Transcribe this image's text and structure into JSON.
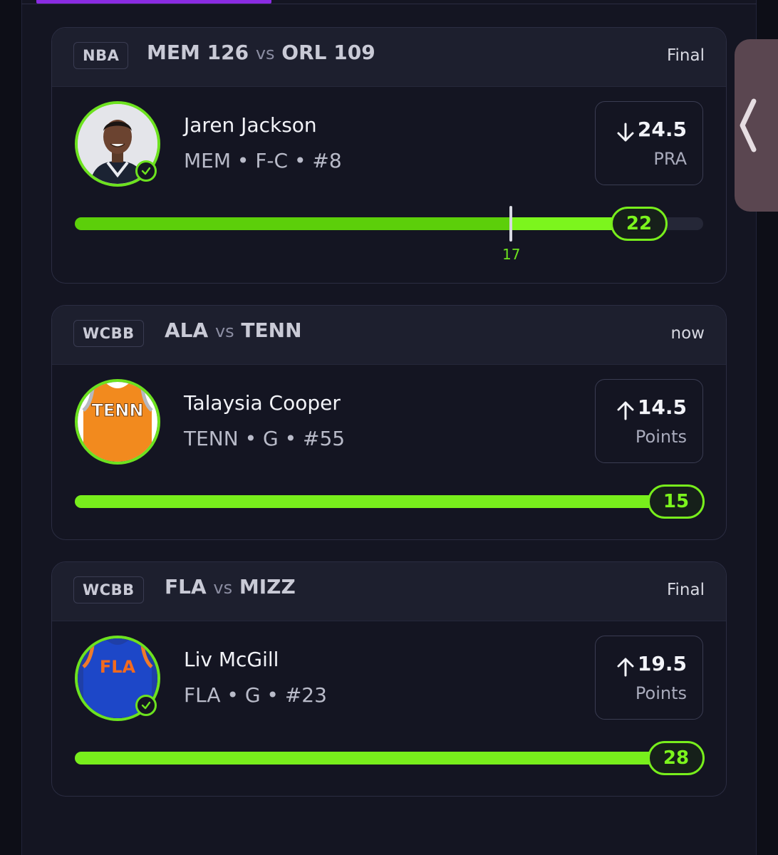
{
  "colors": {
    "accent": "#6de21f",
    "bar": "#78ee1c",
    "tab": "#8a2be2",
    "background": "#141522"
  },
  "cards": [
    {
      "league": "NBA",
      "team_a": "MEM",
      "score_a": "126",
      "vs": "vs",
      "team_b": "ORL",
      "score_b": "109",
      "status": "Final",
      "player": {
        "name": "Jaren Jackson",
        "info": "MEM • F-C • #8",
        "avatar": "player-headshot",
        "checked": true
      },
      "line": {
        "direction": "down",
        "value": "24.5",
        "stat": "PRA"
      },
      "progress": {
        "result": "22",
        "marker": "17",
        "fill_fraction": 0.92,
        "marker_fraction": 0.694
      }
    },
    {
      "league": "WCBB",
      "team_a": "ALA",
      "vs": "vs",
      "team_b": "TENN",
      "status": "now",
      "player": {
        "name": "Talaysia Cooper",
        "info": "TENN • G • #55",
        "avatar": "jersey-orange",
        "jersey_text": "TENN",
        "checked": false
      },
      "line": {
        "direction": "up",
        "value": "14.5",
        "stat": "Points"
      },
      "progress": {
        "result": "15",
        "fill_fraction": 1.0
      }
    },
    {
      "league": "WCBB",
      "team_a": "FLA",
      "vs": "vs",
      "team_b": "MIZZ",
      "status": "Final",
      "player": {
        "name": "Liv McGill",
        "info": "FLA • G • #23",
        "avatar": "jersey-blue",
        "jersey_text": "FLA",
        "checked": true
      },
      "line": {
        "direction": "up",
        "value": "19.5",
        "stat": "Points"
      },
      "progress": {
        "result": "28",
        "fill_fraction": 1.0
      }
    }
  ]
}
